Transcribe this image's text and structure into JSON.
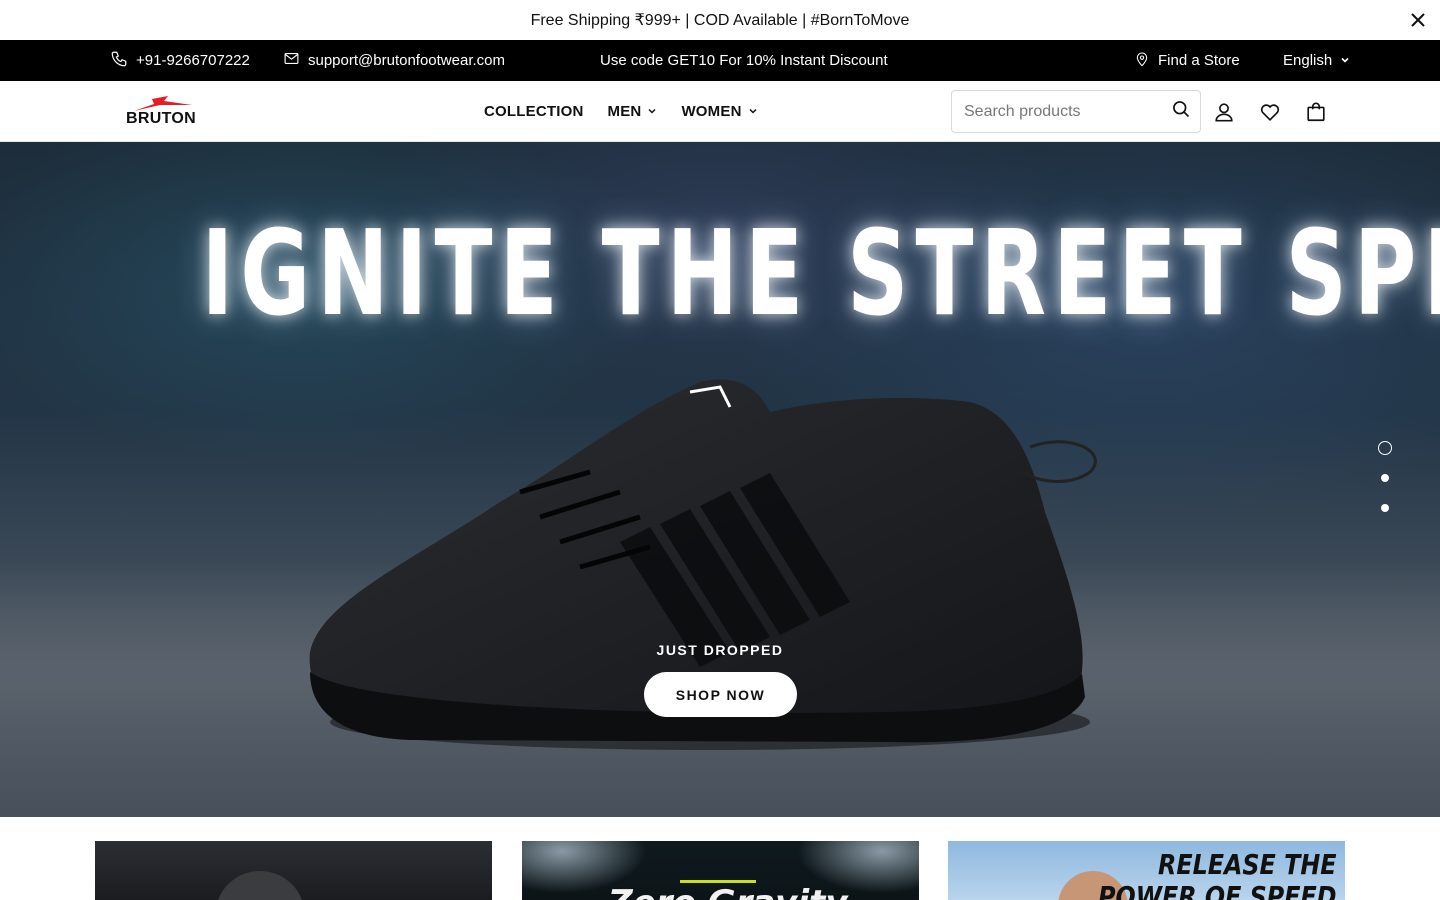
{
  "announcement": {
    "text": "Free Shipping ₹999+ | COD Available | #BornToMove"
  },
  "topbar": {
    "phone": "+91-9266707222",
    "email": "support@brutonfootwear.com",
    "promo": "Use code GET10 For 10% Instant Discount",
    "find_store": "Find a Store",
    "language": "English"
  },
  "header": {
    "logo_text": "BRUTON",
    "nav": {
      "collection": "COLLECTION",
      "men": "MEN",
      "women": "WOMEN"
    },
    "search": {
      "placeholder": "Search products"
    }
  },
  "hero": {
    "headline": "IGNITE THE STREET SPIRIT",
    "tagline": "JUST DROPPED",
    "cta": "SHOP NOW",
    "slides_total": 3,
    "active_slide": 1
  },
  "cards": {
    "card2_text": "Zero Gravity",
    "card3_text_line1": "RELEASE THE",
    "card3_text_line2": "POWER OF SPEED"
  },
  "colors": {
    "topbar_bg": "#000000",
    "accent_red": "#e31e24",
    "card_accent": "#c7e11a"
  }
}
